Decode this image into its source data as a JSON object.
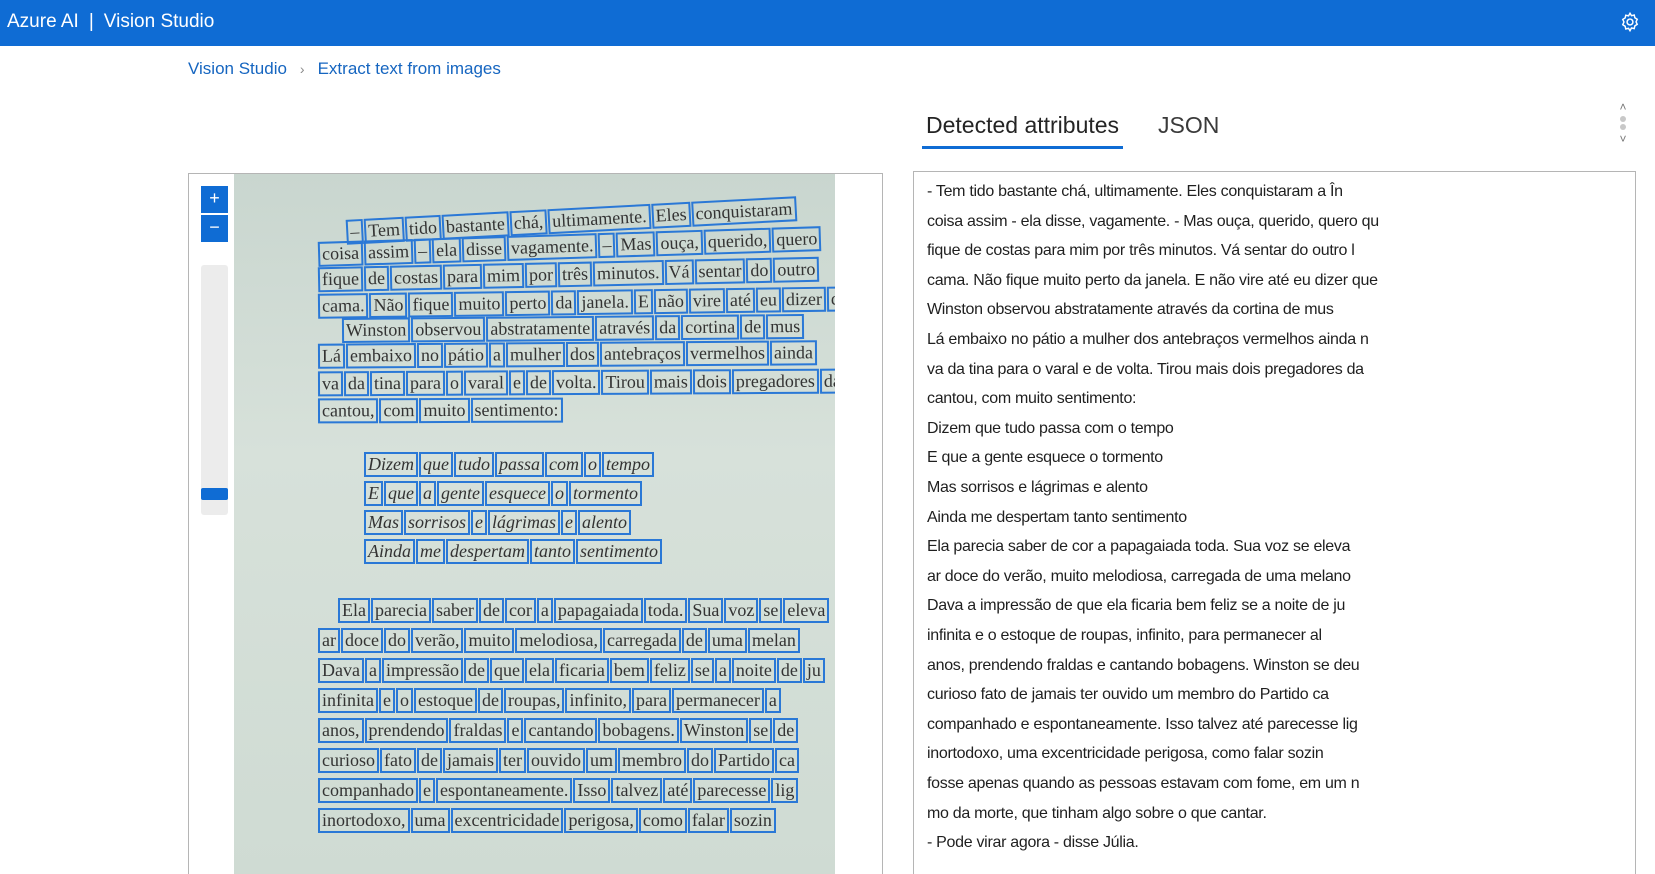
{
  "header": {
    "brand": "Azure AI",
    "separator": "|",
    "product": "Vision Studio",
    "settings_icon": "gear-icon"
  },
  "breadcrumb": {
    "home": "Vision Studio",
    "current": "Extract text from images"
  },
  "tabs": {
    "detected": "Detected attributes",
    "json": "JSON"
  },
  "zoom": {
    "in_label": "+",
    "out_label": "−"
  },
  "colors": {
    "accent": "#0f6cd4",
    "box": "#2a78d6"
  },
  "image_lines": [
    [
      "–",
      "Tem",
      "tido",
      "bastante",
      "chá,",
      "ultimamente.",
      "Eles",
      "conquistaram"
    ],
    [
      "coisa",
      "assim",
      "–",
      "ela",
      "disse",
      "vagamente.",
      "–",
      "Mas",
      "ouça,",
      "querido,",
      "quero"
    ],
    [
      "fique",
      "de",
      "costas",
      "para",
      "mim",
      "por",
      "três",
      "minutos.",
      "Vá",
      "sentar",
      "do",
      "outro"
    ],
    [
      "cama.",
      "Não",
      "fique",
      "muito",
      "perto",
      "da",
      "janela.",
      "E",
      "não",
      "vire",
      "até",
      "eu",
      "dizer",
      "que"
    ],
    [
      "Winston",
      "observou",
      "abstratamente",
      "através",
      "da",
      "cortina",
      "de",
      "mus"
    ],
    [
      "Lá",
      "embaixo",
      "no",
      "pátio",
      "a",
      "mulher",
      "dos",
      "antebraços",
      "vermelhos",
      "ainda"
    ],
    [
      "va",
      "da",
      "tina",
      "para",
      "o",
      "varal",
      "e",
      "de",
      "volta.",
      "Tirou",
      "mais",
      "dois",
      "pregadores",
      "da"
    ],
    [
      "cantou,",
      "com",
      "muito",
      "sentimento:"
    ],
    [
      "Dizem",
      "que",
      "tudo",
      "passa",
      "com",
      "o",
      "tempo"
    ],
    [
      "E",
      "que",
      "a",
      "gente",
      "esquece",
      "o",
      "tormento"
    ],
    [
      "Mas",
      "sorrisos",
      "e",
      "lágrimas",
      "e",
      "alento"
    ],
    [
      "Ainda",
      "me",
      "despertam",
      "tanto",
      "sentimento"
    ],
    [
      "Ela",
      "parecia",
      "saber",
      "de",
      "cor",
      "a",
      "papagaiada",
      "toda.",
      "Sua",
      "voz",
      "se",
      "eleva"
    ],
    [
      "ar",
      "doce",
      "do",
      "verão,",
      "muito",
      "melodiosa,",
      "carregada",
      "de",
      "uma",
      "melan"
    ],
    [
      "Dava",
      "a",
      "impressão",
      "de",
      "que",
      "ela",
      "ficaria",
      "bem",
      "feliz",
      "se",
      "a",
      "noite",
      "de",
      "ju"
    ],
    [
      "infinita",
      "e",
      "o",
      "estoque",
      "de",
      "roupas,",
      "infinito,",
      "para",
      "permanecer",
      "a"
    ],
    [
      "anos,",
      "prendendo",
      "fraldas",
      "e",
      "cantando",
      "bobagens.",
      "Winston",
      "se",
      "de"
    ],
    [
      "curioso",
      "fato",
      "de",
      "jamais",
      "ter",
      "ouvido",
      "um",
      "membro",
      "do",
      "Partido",
      "ca"
    ],
    [
      "companhado",
      "e",
      "espontaneamente.",
      "Isso",
      "talvez",
      "até",
      "parecesse",
      "lig"
    ],
    [
      "inortodoxo,",
      "uma",
      "excentricidade",
      "perigosa,",
      "como",
      "falar",
      "sozin"
    ]
  ],
  "result_lines": [
    "- Tem tido bastante chá, ultimamente. Eles conquistaram a În",
    "coisa assim - ela disse, vagamente. - Mas ouça, querido, quero qu",
    "fique de costas para mim por três minutos. Vá sentar do outro l",
    "cama. Não fique muito perto da janela. E não vire até eu dizer que",
    "Winston observou abstratamente através da cortina de mus",
    "Lá embaixo no pátio a mulher dos antebraços vermelhos ainda n",
    "va da tina para o varal e de volta. Tirou mais dois pregadores da",
    "cantou, com muito sentimento:",
    "Dizem que tudo passa com o tempo",
    "E que a gente esquece o tormento",
    "Mas sorrisos e lágrimas e alento",
    "Ainda me despertam tanto sentimento",
    "Ela parecia saber de cor a papagaiada toda. Sua voz se eleva",
    "ar doce do verão, muito melodiosa, carregada de uma melano",
    "Dava a impressão de que ela ficaria bem feliz se a noite de ju",
    "infinita e o estoque de roupas, infinito, para permanecer al",
    "anos, prendendo fraldas e cantando bobagens. Winston se deu",
    "curioso fato de jamais ter ouvido um membro do Partido ca",
    "companhado e espontaneamente. Isso talvez até parecesse lig",
    "inortodoxo, uma excentricidade perigosa, como falar sozin",
    "fosse apenas quando as pessoas estavam com fome, em um n",
    "mo da morte, que tinham algo sobre o que cantar.",
    "- Pode virar agora - disse Júlia."
  ]
}
